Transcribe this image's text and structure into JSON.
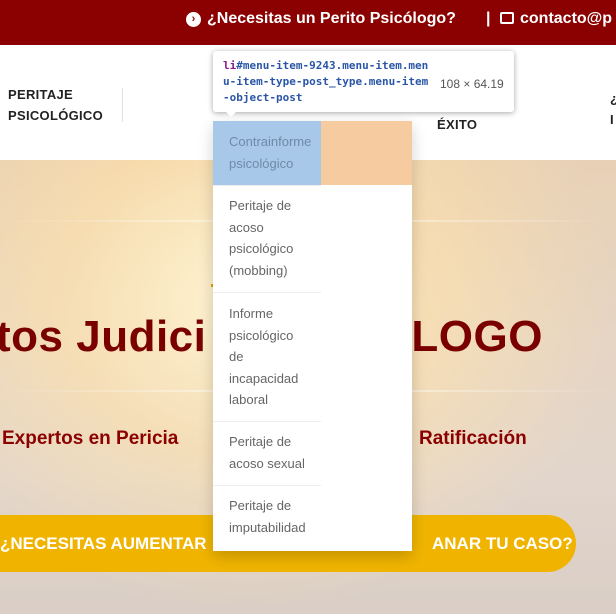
{
  "topbar": {
    "question": "¿Necesitas un Perito Psicólogo?",
    "separator": "|",
    "contact": "contacto@p"
  },
  "nav": {
    "peritaje_line1": "PERITAJE",
    "peritaje_line2": "PSICOLÓGICO",
    "exito": "ÉXITO",
    "edge_mark_top": "¿",
    "edge_mark_bottom": "I"
  },
  "hero": {
    "title_left": "tos Judici",
    "title_right": "CÓLOGO",
    "subtitle_left": "Expertos en Pericia",
    "subtitle_right": "Ratificación",
    "cta_left": "¿NECESITAS AUMENTAR",
    "cta_right": "ANAR TU CASO?"
  },
  "dropdown": {
    "items": [
      {
        "line1": "Contrainforme",
        "line2": "psicológico"
      },
      {
        "line1": "Peritaje de",
        "line2": "acoso",
        "line3": "psicológico",
        "line4": "(mobbing)"
      },
      {
        "line1": "Informe",
        "line2": "psicológico",
        "line3": "de",
        "line4": "incapacidad",
        "line5": "laboral"
      },
      {
        "line1": "Peritaje de",
        "line2": "acoso sexual"
      },
      {
        "line1": "Peritaje de",
        "line2": "imputabilidad"
      }
    ]
  },
  "inspector": {
    "selector_tag": "li",
    "selector_rest": "#menu-item-9243.menu-item.menu-item-type-post_type.menu-item-object-post",
    "dimensions": "108 × 64.19"
  },
  "colors": {
    "brand_red": "#8b0000",
    "cta_yellow": "#f0b400",
    "highlight_content": "#a8c8ea",
    "highlight_margin": "#f7cba0"
  },
  "icons": {
    "question": "chevron-right-circle-icon",
    "contact": "envelope-icon"
  }
}
